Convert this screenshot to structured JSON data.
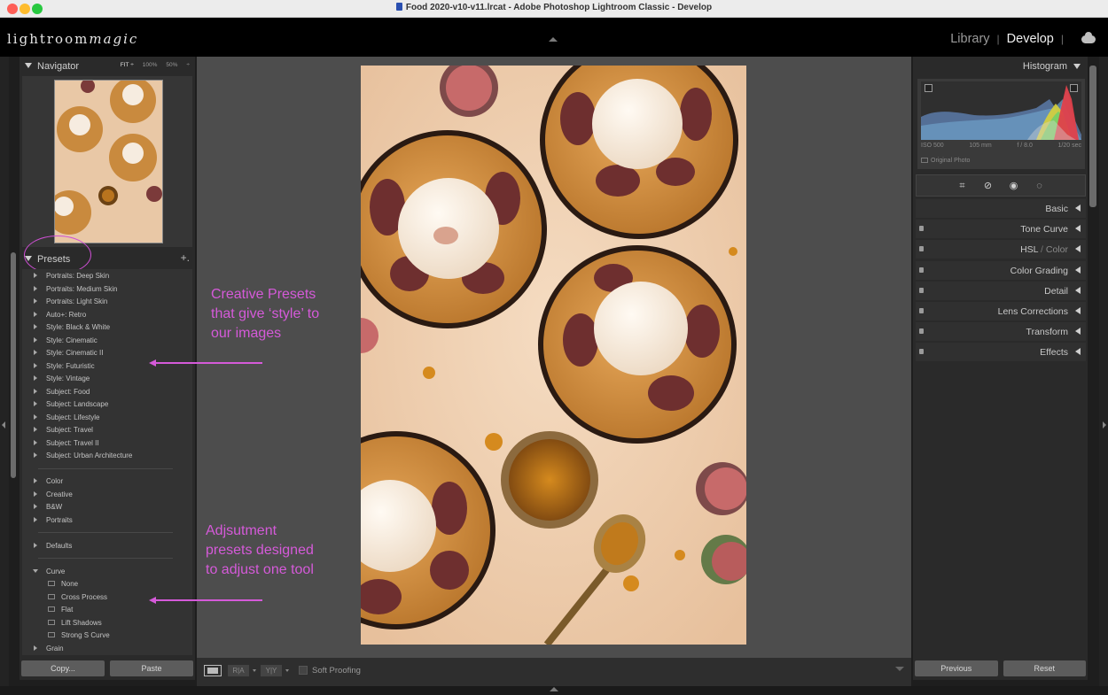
{
  "window": {
    "title": "Food 2020-v10-v11.lrcat - Adobe Photoshop Lightroom Classic - Develop"
  },
  "identity_plate": {
    "text_plain": "lightroom",
    "text_script": "magic"
  },
  "module_picker": {
    "library": "Library",
    "develop": "Develop",
    "active": "Develop",
    "cloud_icon": "cloud-icon"
  },
  "navigator": {
    "title": "Navigator",
    "zoom_options": [
      "FIT ÷",
      "100%",
      "50%",
      "÷"
    ]
  },
  "presets": {
    "title": "Presets",
    "add_label": "+.",
    "groups_top": [
      "Portraits: Deep Skin",
      "Portraits: Medium Skin",
      "Portraits: Light Skin",
      "Auto+: Retro",
      "Style: Black & White",
      "Style: Cinematic",
      "Style: Cinematic II",
      "Style: Futuristic",
      "Style: Vintage",
      "Subject: Food",
      "Subject: Landscape",
      "Subject: Lifestyle",
      "Subject: Travel",
      "Subject: Travel II",
      "Subject: Urban Architecture"
    ],
    "groups_adjust": [
      "Color",
      "Creative",
      "B&W",
      "Portraits"
    ],
    "groups_defaults": [
      "Defaults"
    ],
    "curve_group": "Curve",
    "curve_items": [
      "None",
      "Cross Process",
      "Flat",
      "Lift Shadows",
      "Strong S Curve"
    ],
    "last_group": "Grain"
  },
  "left_footer": {
    "copy": "Copy...",
    "paste": "Paste"
  },
  "toolbar": {
    "ra_label": "R|A",
    "yy_label": "Y|Y",
    "soft_proofing": "Soft Proofing"
  },
  "histogram": {
    "title": "Histogram",
    "iso": "ISO 500",
    "focal": "105 mm",
    "aperture": "f / 8.0",
    "shutter": "1/20 sec",
    "original_photo": "Original Photo"
  },
  "tools": [
    "crop-icon",
    "healing-icon",
    "red-eye-icon",
    "mask-icon"
  ],
  "develop_sections": [
    {
      "label": "Basic"
    },
    {
      "label": "Tone Curve"
    },
    {
      "label": "HSL",
      "label_b": "Color"
    },
    {
      "label": "Color Grading"
    },
    {
      "label": "Detail"
    },
    {
      "label": "Lens Corrections"
    },
    {
      "label": "Transform"
    },
    {
      "label": "Effects"
    }
  ],
  "right_footer": {
    "previous": "Previous",
    "reset": "Reset"
  },
  "annotations": {
    "creative_lines": [
      "Creative Presets",
      "that give ‘style’ to",
      "our images"
    ],
    "adjust_lines": [
      "Adjsutment",
      "presets designed",
      "to adjust one tool"
    ],
    "color": "#d55ad9"
  }
}
